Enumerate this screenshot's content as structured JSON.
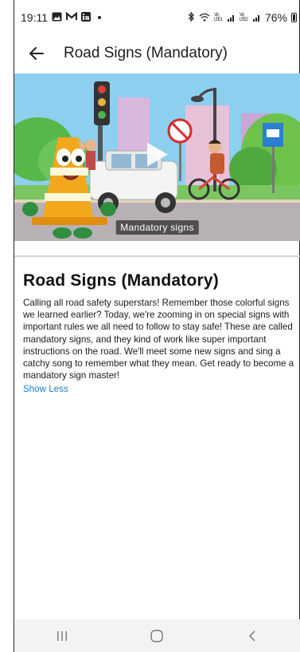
{
  "status_bar": {
    "time": "19:11",
    "notification_icons": [
      "gallery-icon",
      "gmail-icon",
      "linkedin-icon"
    ],
    "signal_text_1": "Vo LTE1",
    "signal_text_2": "Vo LTE2",
    "battery": "76%"
  },
  "app_bar": {
    "title": "Road Signs (Mandatory)"
  },
  "video": {
    "caption": "Mandatory signs"
  },
  "content": {
    "heading": "Road Signs (Mandatory)",
    "description_lines": [
      "Calling all road safety superstars! Remember those colorful signs",
      "we learned earlier? Today, we're zooming in on special signs with",
      "important rules we all need to follow to stay safe! These are called",
      "mandatory signs, and they kind of work like super important",
      "instructions on the road. We'll meet some new signs and sing a",
      "catchy song to remember what they mean. Get ready to become a",
      "mandatory sign master!"
    ],
    "toggle_label": "Show Less"
  },
  "colors": {
    "link": "#1a7fc4",
    "divider": "#cfd4d8",
    "nav_bg": "#f3f3f5"
  }
}
